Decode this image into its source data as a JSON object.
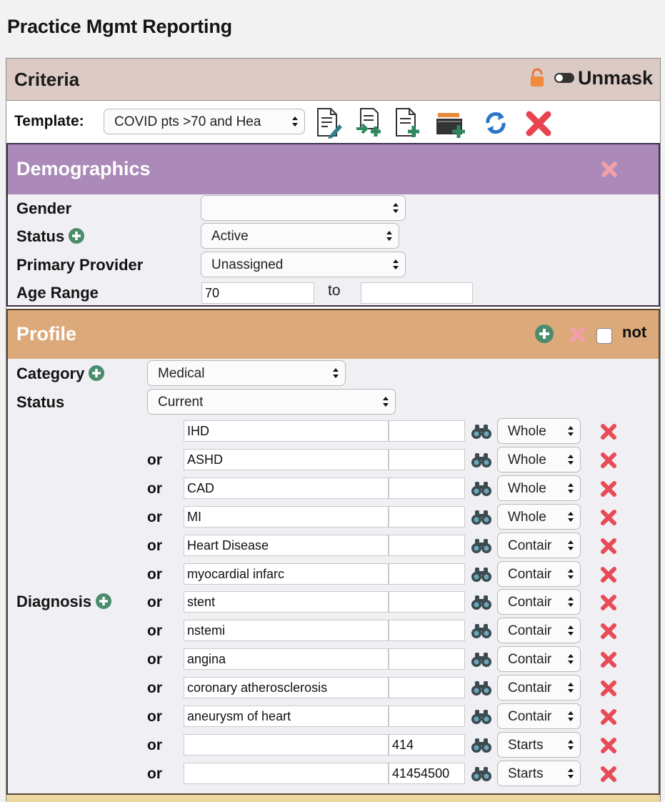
{
  "page": {
    "title": "Practice Mgmt Reporting"
  },
  "criteria": {
    "title": "Criteria",
    "unmask_label": "Unmask",
    "template_label": "Template:",
    "template_value": "COVID pts >70 and Hea"
  },
  "demographics": {
    "title": "Demographics",
    "gender_label": "Gender",
    "gender_value": "",
    "status_label": "Status",
    "status_value": "Active",
    "provider_label": "Primary Provider",
    "provider_value": "Unassigned",
    "age_label": "Age Range",
    "age_from": "70",
    "age_to_label": "to",
    "age_to": ""
  },
  "profile": {
    "title": "Profile",
    "not_label": "not",
    "category_label": "Category",
    "category_value": "Medical",
    "status_label": "Status",
    "status_value": "Current",
    "diagnosis_label": "Diagnosis",
    "or_label": "or",
    "diagnoses": [
      {
        "term": "IHD",
        "code": "",
        "match": "Whole"
      },
      {
        "term": "ASHD",
        "code": "",
        "match": "Whole"
      },
      {
        "term": "CAD",
        "code": "",
        "match": "Whole"
      },
      {
        "term": "MI",
        "code": "",
        "match": "Whole"
      },
      {
        "term": "Heart Disease",
        "code": "",
        "match": "Contair"
      },
      {
        "term": "myocardial infarc",
        "code": "",
        "match": "Contair"
      },
      {
        "term": "stent",
        "code": "",
        "match": "Contair"
      },
      {
        "term": "nstemi",
        "code": "",
        "match": "Contair"
      },
      {
        "term": "angina",
        "code": "",
        "match": "Contair"
      },
      {
        "term": "coronary atherosclerosis",
        "code": "",
        "match": "Contair"
      },
      {
        "term": "aneurysm of heart",
        "code": "",
        "match": "Contair"
      },
      {
        "term": "",
        "code": "414",
        "match": "Starts"
      },
      {
        "term": "",
        "code": "41454500",
        "match": "Starts"
      }
    ]
  },
  "colors": {
    "criteria_header": "#dccac5",
    "demographics_header": "#ab89b8",
    "profile_header": "#dca97a",
    "plus_green": "#4a8c6c",
    "delete_red": "#e84b55"
  }
}
